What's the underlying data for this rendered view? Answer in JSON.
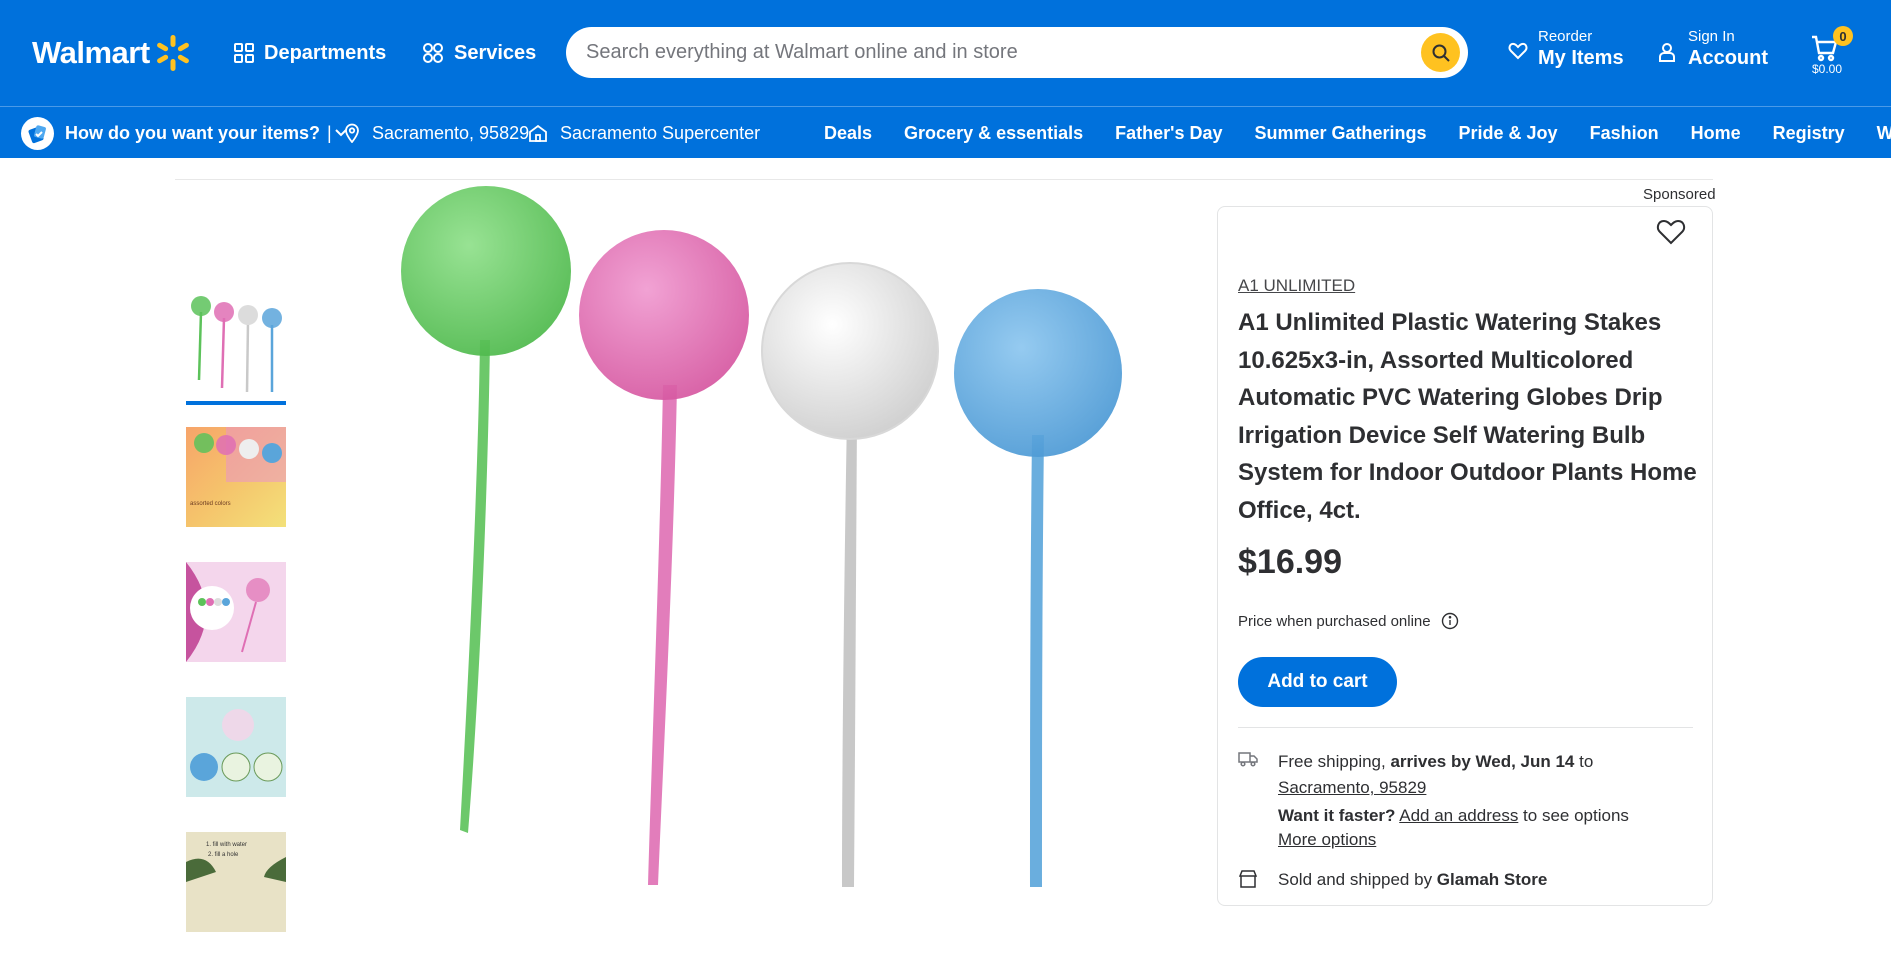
{
  "header": {
    "logo_text": "Walmart",
    "departments_label": "Departments",
    "services_label": "Services",
    "search_placeholder": "Search everything at Walmart online and in store",
    "reorder_small": "Reorder",
    "reorder_big": "My Items",
    "signin_small": "Sign In",
    "signin_big": "Account",
    "cart_count": "0",
    "cart_total": "$0.00",
    "brand_color": "#0071dc",
    "accent_color": "#ffc220"
  },
  "subnav": {
    "fulfillment_prompt": "How do you want your items?",
    "separator": "|",
    "location": "Sacramento, 95829",
    "store": "Sacramento Supercenter",
    "links": [
      "Deals",
      "Grocery & essentials",
      "Father's Day",
      "Summer Gatherings",
      "Pride & Joy",
      "Fashion",
      "Home",
      "Registry",
      "Walmart+"
    ]
  },
  "product": {
    "sponsored_label": "Sponsored",
    "brand": "A1 UNLIMITED",
    "title": "A1 Unlimited Plastic Watering Stakes 10.625x3-in, Assorted Multicolored Automatic PVC Watering Globes Drip Irrigation Device Self Watering Bulb System for Indoor Outdoor Plants Home Office, 4ct.",
    "price": "$16.99",
    "price_note": "Price when purchased online",
    "add_to_cart": "Add to cart",
    "shipping_prefix": "Free shipping, ",
    "shipping_bold": "arrives by Wed, Jun 14",
    "shipping_to": " to",
    "shipping_location": "Sacramento, 95829",
    "faster_bold": "Want it faster?",
    "faster_link": "Add an address",
    "faster_suffix": " to see options",
    "more_options": "More options",
    "sold_prefix": "Sold and shipped by ",
    "seller": "Glamah Store"
  },
  "images": {
    "thumbnail_count": 5,
    "selected_thumbnail": 1,
    "globe_colors": [
      "#5cc25a",
      "#df6fb4",
      "#d9d9d9",
      "#5aa5da"
    ]
  },
  "icons": [
    "spark-icon",
    "grid-icon",
    "services-icon",
    "search-icon",
    "heart-icon",
    "person-icon",
    "cart-icon",
    "fulfillment-icon",
    "chevron-down-icon",
    "location-pin-icon",
    "store-icon",
    "favorite-heart-icon",
    "info-icon",
    "truck-icon",
    "store-small-icon"
  ]
}
